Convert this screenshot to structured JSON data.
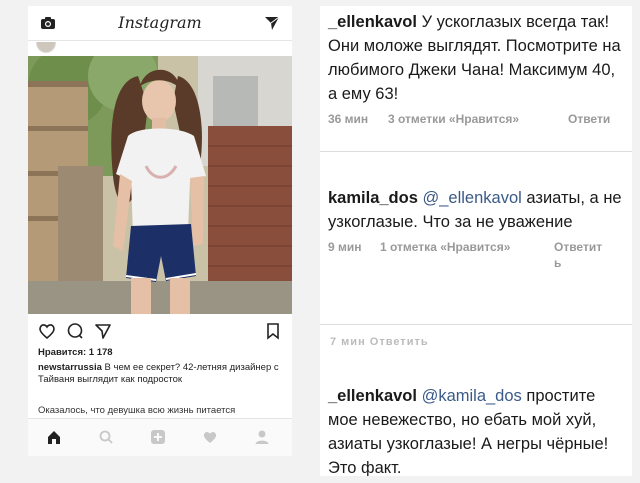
{
  "instagram": {
    "logo_text": "Instagram",
    "likes": "Нравится: 1 178",
    "caption_user": "newstarrussia",
    "caption_text": " В чем ее секрет? 42-летняя дизайнер с Тайваня выглядит как подросток",
    "more_text": "Оказалось, что девушка всю жизнь питается",
    "nav_icons": [
      "home-icon",
      "search-icon",
      "add-icon",
      "heart-icon",
      "profile-icon"
    ]
  },
  "comments": [
    {
      "user": "_ellenkavol",
      "text": " У ускоглазых всегда так! Они моложе выглядят. Посмотрите на любимого Джеки Чана! Максимум 40, а ему 63!",
      "time": "36 мин",
      "likes": "3 отметки «Нравится»",
      "reply": "Ответи"
    },
    {
      "user": "kamila_dos",
      "mention": "@_ellenkavol",
      "text": " азиаты, а не узкоглазые. Что за не уважение",
      "time": "9 мин",
      "likes": "1 отметка «Нравится»",
      "reply": "Ответит",
      "reply2": "ь"
    },
    {
      "user": "_ellenkavol",
      "mention": "@kamila_dos",
      "text": " простите мое невежество, но ебать мой хуй, азиаты узкоглазые! А негры чёрные! Это факт."
    }
  ],
  "ghost_texts": [
    "7 мин  Ответить"
  ],
  "colors": {
    "mention": "#3a5a87",
    "meta": "#999999"
  }
}
